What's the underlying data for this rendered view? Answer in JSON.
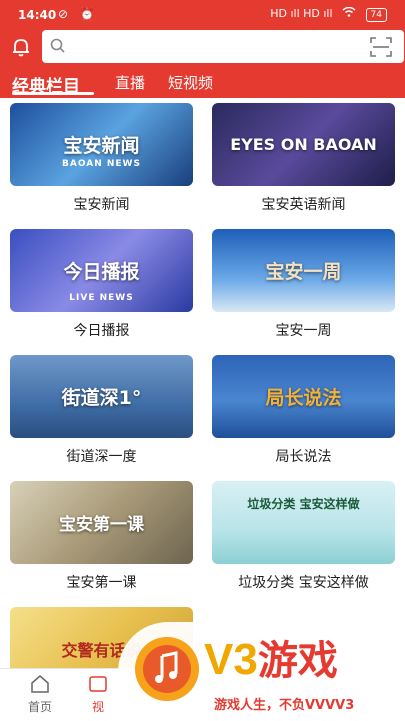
{
  "status_bar": {
    "time": "14:40",
    "left_icons": "⊘ ⏰",
    "network": "HD ıll HD ıll",
    "wifi": "📶",
    "battery": "74"
  },
  "search": {
    "placeholder": ""
  },
  "tabs": [
    {
      "label": "经典栏目",
      "active": true
    },
    {
      "label": "直播",
      "active": false
    },
    {
      "label": "短视频",
      "active": false
    }
  ],
  "programs": [
    {
      "title": "宝安新闻",
      "thumb_text": "宝安新闻",
      "thumb_sub": "BAOAN NEWS"
    },
    {
      "title": "宝安英语新闻",
      "thumb_text": "EYES ON BAOAN",
      "thumb_sub": ""
    },
    {
      "title": "今日播报",
      "thumb_text": "今日播报",
      "thumb_sub": "LIVE NEWS"
    },
    {
      "title": "宝安一周",
      "thumb_text": "宝安一周",
      "thumb_sub": ""
    },
    {
      "title": "街道深一度",
      "thumb_text": "街道深1°",
      "thumb_sub": ""
    },
    {
      "title": "局长说法",
      "thumb_text": "局长说法",
      "thumb_sub": ""
    },
    {
      "title": "宝安第一课",
      "thumb_text": "宝安第一课",
      "thumb_sub": ""
    },
    {
      "title": "垃圾分类 宝安这样做",
      "thumb_text": "垃圾分类 宝安这样做",
      "thumb_sub": ""
    },
    {
      "title": "",
      "thumb_text": "交警有话说",
      "thumb_sub": ""
    }
  ],
  "bottom_nav": [
    {
      "label": "首页",
      "active": false
    },
    {
      "label": "视",
      "active": true
    }
  ],
  "watermark": {
    "title": "V3",
    "title_cn": "游戏",
    "slogan": "游戏人生，不负VVVV3"
  },
  "colors": {
    "brand_red": "#e43a2f",
    "watermark_gold": "#f0a800"
  }
}
